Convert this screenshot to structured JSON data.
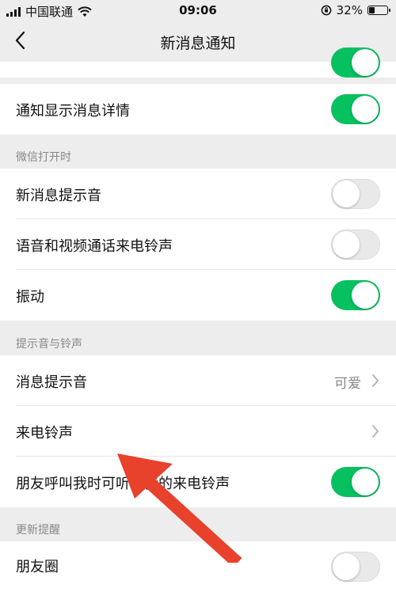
{
  "status_bar": {
    "carrier": "中国联通",
    "time": "09:06",
    "battery_text": "32%",
    "lock_icon": "orientation-lock-icon",
    "wifi_icon": "wifi-icon"
  },
  "nav": {
    "title": "新消息通知",
    "back_icon": "chevron-left-icon"
  },
  "rows": {
    "show_details": {
      "label": "通知显示消息详情",
      "on": true
    },
    "new_msg_sound": {
      "label": "新消息提示音",
      "on": false
    },
    "call_ringtone_toggle": {
      "label": "语音和视频通话来电铃声",
      "on": false
    },
    "vibrate": {
      "label": "振动",
      "on": true
    },
    "msg_sound": {
      "label": "消息提示音",
      "value": "可爱"
    },
    "call_ringtone": {
      "label": "来电铃声"
    },
    "friend_ringtone": {
      "label": "朋友呼叫我时可听到我的来电铃声",
      "on": true
    },
    "moments": {
      "label": "朋友圈",
      "on": false
    }
  },
  "sections": {
    "wechat_open": "微信打开时",
    "sound_ringtone": "提示音与铃声",
    "update_reminder": "更新提醒"
  },
  "colors": {
    "accent": "#07c160",
    "arrow": "#e8412c",
    "background": "#ededed"
  }
}
